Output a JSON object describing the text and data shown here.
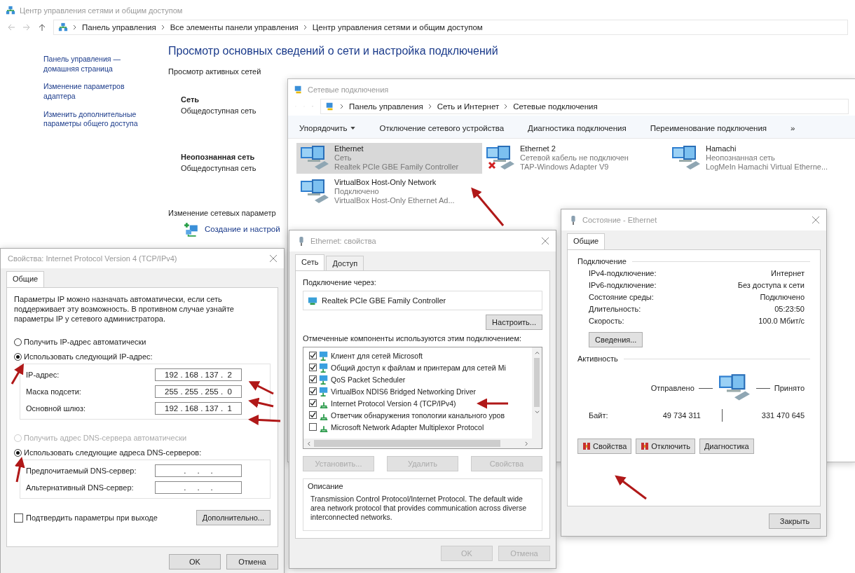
{
  "main_window": {
    "title": "Центр управления сетями и общим доступом",
    "breadcrumb": [
      "Панель управления",
      "Все элементы панели управления",
      "Центр управления сетями и общим доступом"
    ],
    "sidebar_links": [
      "Панель управления — домашняя страница",
      "Изменение параметров адаптера",
      "Изменить дополнительные параметры общего доступа"
    ],
    "heading": "Просмотр основных сведений о сети и настройка подключений",
    "active_networks_label": "Просмотр активных сетей",
    "networks": [
      {
        "name": "Сеть",
        "type": "Общедоступная сеть"
      },
      {
        "name": "Неопознанная сеть",
        "type": "Общедоступная сеть"
      }
    ],
    "change_settings_label": "Изменение сетевых параметр",
    "setup_link": "Создание и настрой"
  },
  "connections_window": {
    "title": "Сетевые подключения",
    "breadcrumb": [
      "Панель управления",
      "Сеть и Интернет",
      "Сетевые подключения"
    ],
    "toolbar": [
      {
        "label": "Упорядочить",
        "kind": "menu"
      },
      {
        "label": "Отключение сетевого устройства",
        "kind": "action"
      },
      {
        "label": "Диагностика подключения",
        "kind": "action"
      },
      {
        "label": "Переименование подключения",
        "kind": "action"
      },
      {
        "label": "»",
        "kind": "overflow"
      }
    ],
    "adapters": [
      {
        "name": "Ethernet",
        "status": "Сеть",
        "device": "Realtek PCIe GBE Family Controller",
        "selected": true,
        "disconnected": false
      },
      {
        "name": "Ethernet 2",
        "status": "Сетевой кабель не подключен",
        "device": "TAP-Windows Adapter V9",
        "selected": false,
        "disconnected": true
      },
      {
        "name": "Hamachi",
        "status": "Неопознанная сеть",
        "device": "LogMeIn Hamachi Virtual Etherne...",
        "selected": false,
        "disconnected": false
      },
      {
        "name": "VirtualBox Host-Only Network",
        "status": "Подключено",
        "device": "VirtualBox Host-Only Ethernet Ad...",
        "selected": false,
        "disconnected": false
      }
    ]
  },
  "ipv4_window": {
    "title": "Свойства: Internet Protocol Version 4 (TCP/IPv4)",
    "tab": "Общие",
    "description": "Параметры IP можно назначать автоматически, если сеть поддерживает эту возможность. В противном случае узнайте параметры IP у сетевого администратора.",
    "ip_options": [
      {
        "label": "Получить IP-адрес автоматически",
        "selected": false,
        "disabled": false
      },
      {
        "label": "Использовать следующий IP-адрес:",
        "selected": true,
        "disabled": false
      }
    ],
    "ip_fields": [
      {
        "label": "IP-адрес:",
        "value": "192 . 168 . 137 .  2"
      },
      {
        "label": "Маска подсети:",
        "value": "255 . 255 . 255 .  0"
      },
      {
        "label": "Основной шлюз:",
        "value": "192 . 168 . 137 .  1"
      }
    ],
    "dns_options": [
      {
        "label": "Получить адрес DNS-сервера автоматически",
        "selected": false,
        "disabled": true
      },
      {
        "label": "Использовать следующие адреса DNS-серверов:",
        "selected": true,
        "disabled": false
      }
    ],
    "dns_fields": [
      {
        "label": "Предпочитаемый DNS-сервер:",
        "value": ".     .     ."
      },
      {
        "label": "Альтернативный DNS-сервер:",
        "value": ".     .     ."
      }
    ],
    "confirm": {
      "label": "Подтвердить параметры при выходе",
      "checked": false
    },
    "advanced_button": "Дополнительно...",
    "buttons": [
      "OK",
      "Отмена"
    ]
  },
  "properties_window": {
    "title": "Ethernet: свойства",
    "tabs": [
      {
        "label": "Сеть",
        "selected": true
      },
      {
        "label": "Доступ",
        "selected": false
      }
    ],
    "connect_using_label": "Подключение через:",
    "adapter": "Realtek PCIe GBE Family Controller",
    "configure_button": "Настроить...",
    "components_label": "Отмеченные компоненты используются этим подключением:",
    "components": [
      {
        "label": "Клиент для сетей Microsoft",
        "checked": true,
        "kind": "service"
      },
      {
        "label": "Общий доступ к файлам и принтерам для сетей Mi",
        "checked": true,
        "kind": "service"
      },
      {
        "label": "QoS Packet Scheduler",
        "checked": true,
        "kind": "service"
      },
      {
        "label": "VirtualBox NDIS6 Bridged Networking Driver",
        "checked": true,
        "kind": "service"
      },
      {
        "label": "Internet Protocol Version 4 (TCP/IPv4)",
        "checked": true,
        "kind": "protocol"
      },
      {
        "label": "Ответчик обнаружения топологии канального уров",
        "checked": true,
        "kind": "protocol"
      },
      {
        "label": "Microsoft Network Adapter Multiplexor Protocol",
        "checked": false,
        "kind": "protocol"
      }
    ],
    "action_buttons": [
      {
        "label": "Установить...",
        "disabled": true
      },
      {
        "label": "Удалить",
        "disabled": true
      },
      {
        "label": "Свойства",
        "disabled": true
      }
    ],
    "description_label": "Описание",
    "description": "Transmission Control Protocol/Internet Protocol. The default wide area network protocol that provides communication across diverse interconnected networks.",
    "footer_buttons": [
      {
        "label": "OK",
        "disabled": true
      },
      {
        "label": "Отмена",
        "disabled": true
      }
    ]
  },
  "status_window": {
    "title": "Состояние - Ethernet",
    "tab": "Общие",
    "connection_label": "Подключение",
    "rows": [
      {
        "label": "IPv4-подключение:",
        "value": "Интернет"
      },
      {
        "label": "IPv6-подключение:",
        "value": "Без доступа к сети"
      },
      {
        "label": "Состояние среды:",
        "value": "Подключено"
      },
      {
        "label": "Длительность:",
        "value": "05:23:50"
      },
      {
        "label": "Скорость:",
        "value": "100.0 Мбит/с"
      }
    ],
    "details_button": "Сведения...",
    "activity_label": "Активность",
    "sent_label": "Отправлено",
    "received_label": "Принято",
    "bytes_label": "Байт:",
    "bytes_sent": "49 734 311",
    "bytes_received": "331 470 645",
    "buttons": [
      {
        "label": "Свойства",
        "shield": true
      },
      {
        "label": "Отключить",
        "shield": true
      },
      {
        "label": "Диагностика",
        "shield": false
      }
    ],
    "close_button": "Закрыть"
  }
}
